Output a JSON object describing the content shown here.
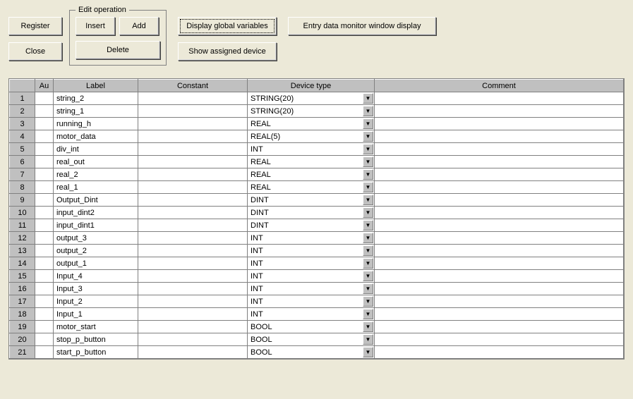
{
  "buttons": {
    "register": "Register",
    "close": "Close",
    "insert": "Insert",
    "add": "Add",
    "delete": "Delete",
    "display_global": "Display global variables",
    "show_assigned": "Show assigned device",
    "entry_monitor": "Entry data monitor window display"
  },
  "groupbox": {
    "edit_operation": "Edit operation"
  },
  "columns": {
    "au": "Au",
    "label": "Label",
    "constant": "Constant",
    "device_type": "Device type",
    "comment": "Comment"
  },
  "rows": [
    {
      "n": "1",
      "au": "",
      "label": "string_2",
      "constant": "",
      "device_type": "STRING(20)",
      "comment": ""
    },
    {
      "n": "2",
      "au": "",
      "label": "string_1",
      "constant": "",
      "device_type": "STRING(20)",
      "comment": ""
    },
    {
      "n": "3",
      "au": "",
      "label": "running_h",
      "constant": "",
      "device_type": "REAL",
      "comment": ""
    },
    {
      "n": "4",
      "au": "",
      "label": "motor_data",
      "constant": "",
      "device_type": "REAL(5)",
      "comment": ""
    },
    {
      "n": "5",
      "au": "",
      "label": "div_int",
      "constant": "",
      "device_type": "INT",
      "comment": ""
    },
    {
      "n": "6",
      "au": "",
      "label": "real_out",
      "constant": "",
      "device_type": "REAL",
      "comment": ""
    },
    {
      "n": "7",
      "au": "",
      "label": "real_2",
      "constant": "",
      "device_type": "REAL",
      "comment": ""
    },
    {
      "n": "8",
      "au": "",
      "label": "real_1",
      "constant": "",
      "device_type": "REAL",
      "comment": ""
    },
    {
      "n": "9",
      "au": "",
      "label": "Output_Dint",
      "constant": "",
      "device_type": "DINT",
      "comment": ""
    },
    {
      "n": "10",
      "au": "",
      "label": "input_dint2",
      "constant": "",
      "device_type": "DINT",
      "comment": ""
    },
    {
      "n": "11",
      "au": "",
      "label": "input_dint1",
      "constant": "",
      "device_type": "DINT",
      "comment": ""
    },
    {
      "n": "12",
      "au": "",
      "label": "output_3",
      "constant": "",
      "device_type": "INT",
      "comment": ""
    },
    {
      "n": "13",
      "au": "",
      "label": "output_2",
      "constant": "",
      "device_type": "INT",
      "comment": ""
    },
    {
      "n": "14",
      "au": "",
      "label": "output_1",
      "constant": "",
      "device_type": "INT",
      "comment": ""
    },
    {
      "n": "15",
      "au": "",
      "label": "Input_4",
      "constant": "",
      "device_type": "INT",
      "comment": ""
    },
    {
      "n": "16",
      "au": "",
      "label": "Input_3",
      "constant": "",
      "device_type": "INT",
      "comment": ""
    },
    {
      "n": "17",
      "au": "",
      "label": "Input_2",
      "constant": "",
      "device_type": "INT",
      "comment": ""
    },
    {
      "n": "18",
      "au": "",
      "label": "Input_1",
      "constant": "",
      "device_type": "INT",
      "comment": ""
    },
    {
      "n": "19",
      "au": "",
      "label": "motor_start",
      "constant": "",
      "device_type": "BOOL",
      "comment": ""
    },
    {
      "n": "20",
      "au": "",
      "label": "stop_p_button",
      "constant": "",
      "device_type": "BOOL",
      "comment": ""
    },
    {
      "n": "21",
      "au": "",
      "label": "start_p_button",
      "constant": "",
      "device_type": "BOOL",
      "comment": ""
    }
  ]
}
